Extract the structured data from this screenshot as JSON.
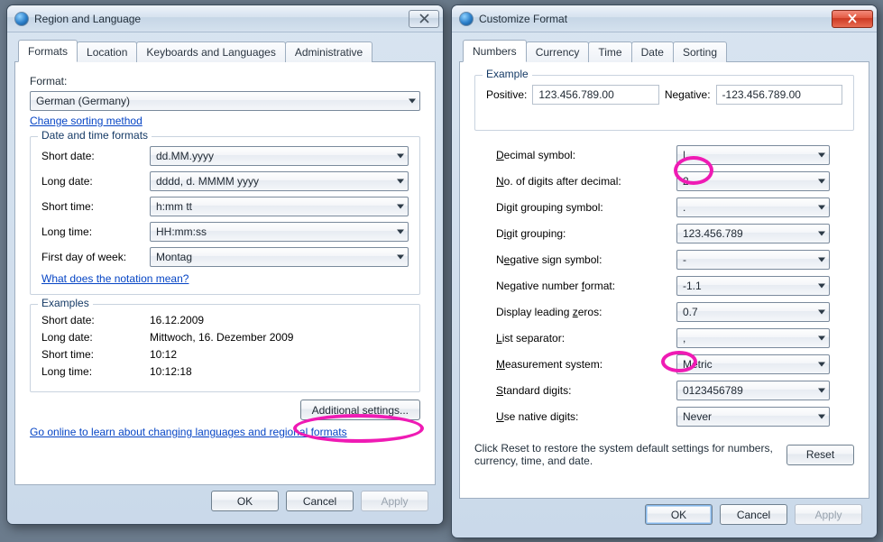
{
  "left": {
    "windowTitle": "Region and Language",
    "tabs": [
      "Formats",
      "Location",
      "Keyboards and Languages",
      "Administrative"
    ],
    "format": {
      "label": "Format:",
      "value": "German (Germany)",
      "sortingLink": "Change sorting method"
    },
    "dateTimeGroup": {
      "legend": "Date and time formats",
      "shortDateLabel": "Short date:",
      "shortDateValue": "dd.MM.yyyy",
      "longDateLabel": "Long date:",
      "longDateValue": "dddd, d. MMMM yyyy",
      "shortTimeLabel": "Short time:",
      "shortTimeValue": "h:mm tt",
      "longTimeLabel": "Long time:",
      "longTimeValue": "HH:mm:ss",
      "firstDayLabel": "First day of week:",
      "firstDayValue": "Montag",
      "notationLink": "What does the notation mean?"
    },
    "examplesGroup": {
      "legend": "Examples",
      "shortDateLabel": "Short date:",
      "shortDateValue": "16.12.2009",
      "longDateLabel": "Long date:",
      "longDateValue": "Mittwoch, 16. Dezember 2009",
      "shortTimeLabel": "Short time:",
      "shortTimeValue": "10:12",
      "longTimeLabel": "Long time:",
      "longTimeValue": "10:12:18"
    },
    "additionalBtn": "Additional settings...",
    "onlineLink": "Go online to learn about changing languages and regional formats",
    "okBtn": "OK",
    "cancelBtn": "Cancel",
    "applyBtn": "Apply"
  },
  "right": {
    "windowTitle": "Customize Format",
    "tabs": [
      "Numbers",
      "Currency",
      "Time",
      "Date",
      "Sorting"
    ],
    "exampleGroup": {
      "legend": "Example",
      "positiveLabel": "Positive:",
      "positiveValue": "123.456.789.00",
      "negativeLabel": "Negative:",
      "negativeValue": "-123.456.789.00"
    },
    "rows": {
      "decimalSymbol": {
        "label": "Decimal symbol:",
        "value": "|"
      },
      "digitsAfter": {
        "label": "No. of digits after decimal:",
        "value": "2"
      },
      "groupingSymbol": {
        "label": "Digit grouping symbol:",
        "value": "."
      },
      "digitGrouping": {
        "label": "Digit grouping:",
        "value": "123.456.789"
      },
      "negativeSign": {
        "label": "Negative sign symbol:",
        "value": "-"
      },
      "negativeFormat": {
        "label": "Negative number format:",
        "value": "-1.1"
      },
      "leadingZeros": {
        "label": "Display leading zeros:",
        "value": "0.7"
      },
      "listSeparator": {
        "label": "List separator:",
        "value": ","
      },
      "measurement": {
        "label": "Measurement system:",
        "value": "Metric"
      },
      "standardDigits": {
        "label": "Standard digits:",
        "value": "0123456789"
      },
      "nativeDigits": {
        "label": "Use native digits:",
        "value": "Never"
      }
    },
    "resetText": "Click Reset to restore the system default settings for numbers, currency, time, and date.",
    "resetBtn": "Reset",
    "okBtn": "OK",
    "cancelBtn": "Cancel",
    "applyBtn": "Apply"
  }
}
